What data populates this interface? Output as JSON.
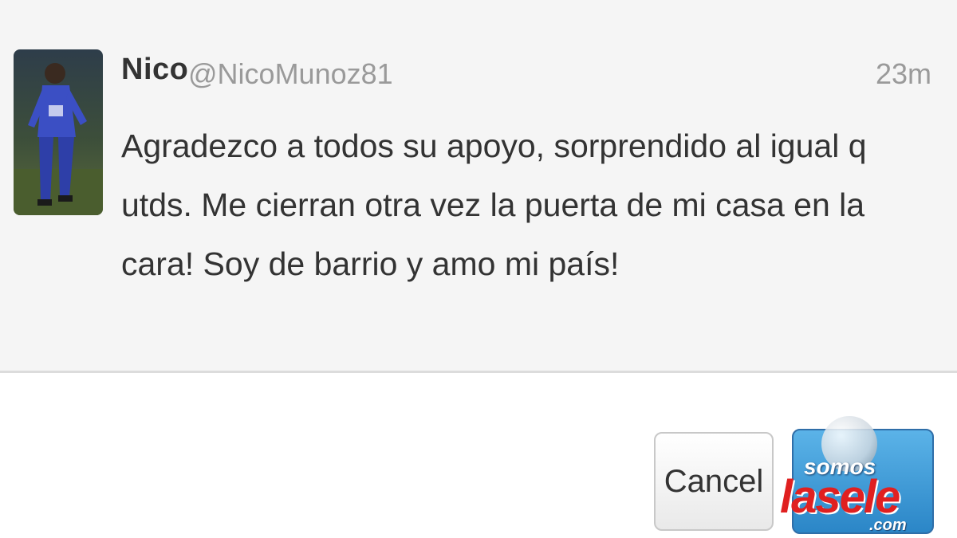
{
  "tweet": {
    "name": "Nico",
    "handle": "@NicoMunoz81",
    "time": "23m",
    "text": "Agradezco a todos su apoyo, sorprendido al igual q utds. Me cierran otra vez la puerta de mi casa en la cara! Soy de barrio y amo mi país!"
  },
  "actions": {
    "cancel_label": "Cancel"
  },
  "watermark": {
    "top": "somos",
    "brand": "lasele",
    "suffix": ".com"
  },
  "icons": {
    "avatar": "profile-photo-football-player"
  },
  "colors": {
    "card_background": "#f5f5f5",
    "text": "#333333",
    "muted": "#9a9a9a",
    "tweet_button": "#2b86c7",
    "watermark_red": "#e02020"
  }
}
